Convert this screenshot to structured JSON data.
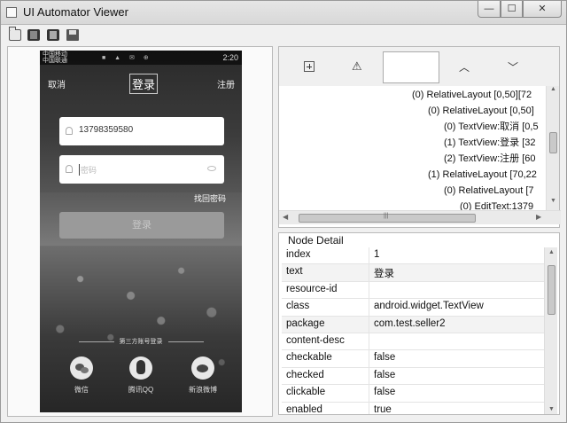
{
  "window": {
    "title": "UI Automator Viewer",
    "controls": {
      "minimize": "—",
      "maximize": "☐",
      "close": "✕"
    }
  },
  "toolbar": {
    "items": [
      "open-icon",
      "device-screenshot-icon",
      "device-screenshot-compressed-icon",
      "save-icon"
    ]
  },
  "phone": {
    "status": {
      "carrier_line1": "中国移动",
      "carrier_line2": "中国联通",
      "icons": "■ ▲ ✉ ⊕",
      "time": "2:20"
    },
    "nav": {
      "cancel": "取消",
      "title": "登录",
      "register": "注册"
    },
    "phone_field": {
      "value": "13798359580"
    },
    "password_field": {
      "placeholder": "密码"
    },
    "forgot_password": "找回密码",
    "login_button": "登录",
    "third_party_label": "第三方账号登录",
    "social": {
      "wechat": "微信",
      "qq": "腾讯QQ",
      "weibo": "新浪微博"
    }
  },
  "hierarchy": {
    "tools": {
      "warn_glyph": "⚠",
      "up_glyph": "︿",
      "down_glyph": "﹀"
    },
    "nodes": [
      "(0) RelativeLayout [0,50][72",
      "(0) RelativeLayout [0,50]",
      "(0) TextView:取消 [0,5",
      "(1) TextView:登录 [32",
      "(2) TextView:注册 [60",
      "(1) RelativeLayout [70,22",
      "(0) RelativeLayout [7",
      "(0) EditText:1379"
    ],
    "scroll_grip": "|||"
  },
  "node_detail": {
    "title": "Node Detail",
    "rows": [
      {
        "key": "index",
        "value": "1"
      },
      {
        "key": "text",
        "value": "登录"
      },
      {
        "key": "resource-id",
        "value": ""
      },
      {
        "key": "class",
        "value": "android.widget.TextView"
      },
      {
        "key": "package",
        "value": "com.test.seller2"
      },
      {
        "key": "content-desc",
        "value": ""
      },
      {
        "key": "checkable",
        "value": "false"
      },
      {
        "key": "checked",
        "value": "false"
      },
      {
        "key": "clickable",
        "value": "false"
      },
      {
        "key": "enabled",
        "value": "true"
      }
    ]
  }
}
